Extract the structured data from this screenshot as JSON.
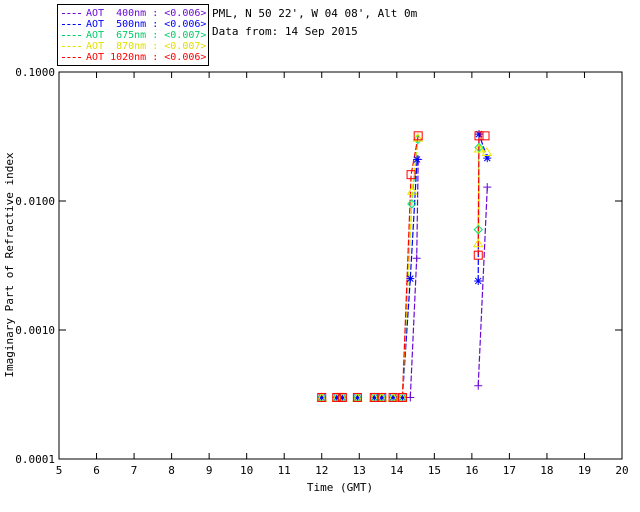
{
  "header": {
    "line1": "PML, N 50 22', W 04 08', Alt 0m",
    "line2": "Data from: 14 Sep 2015"
  },
  "legend": {
    "entries": [
      {
        "label": "AOT  400nm : <0.006>",
        "color": "#6a0ad6"
      },
      {
        "label": "AOT  500nm : <0.006>",
        "color": "#0000ff"
      },
      {
        "label": "AOT  675nm : <0.007>",
        "color": "#00cc66"
      },
      {
        "label": "AOT  870nm : <0.007>",
        "color": "#e0e000"
      },
      {
        "label": "AOT 1020nm : <0.006>",
        "color": "#ff0000"
      }
    ]
  },
  "chart_data": {
    "type": "line",
    "title": "",
    "xlabel": "Time (GMT)",
    "ylabel": "Imaginary Part of Refractive index",
    "xlim": [
      5,
      20
    ],
    "ylim": [
      0.0001,
      0.1
    ],
    "yscale": "log",
    "grid": false,
    "legend_position": "top-left-outside",
    "x_ticks": [
      5,
      6,
      7,
      8,
      9,
      10,
      11,
      12,
      13,
      14,
      15,
      16,
      17,
      18,
      19,
      20
    ],
    "y_ticks": [
      {
        "v": 0.1,
        "label": "0.1000"
      },
      {
        "v": 0.01,
        "label": "0.0100"
      },
      {
        "v": 0.001,
        "label": "0.0010"
      },
      {
        "v": 0.0001,
        "label": "0.0001"
      }
    ],
    "flat_times": [
      12.0,
      12.4,
      12.55,
      12.95,
      13.4,
      13.6,
      13.9
    ],
    "flat_value": 0.0003,
    "series": [
      {
        "name": "AOT 400nm",
        "wavelength": "400nm",
        "mean": "<0.006>",
        "color": "#6a0ad6",
        "marker": "plus",
        "segments": [
          [
            [
              14.36,
              0.0003
            ],
            [
              14.53,
              0.0036
            ],
            [
              14.57,
              0.021
            ]
          ],
          [
            [
              16.17,
              0.00037
            ],
            [
              16.41,
              0.0128
            ]
          ]
        ],
        "extra_points": []
      },
      {
        "name": "AOT 500nm",
        "wavelength": "500nm",
        "mean": "<0.006>",
        "color": "#0000ff",
        "marker": "asterisk",
        "segments": [
          [
            [
              14.15,
              0.0003
            ],
            [
              14.36,
              0.0025
            ],
            [
              14.54,
              0.021
            ]
          ],
          [
            [
              16.17,
              0.0024
            ],
            [
              16.19,
              0.033
            ],
            [
              16.41,
              0.0215
            ]
          ]
        ],
        "extra_points": []
      },
      {
        "name": "AOT 675nm",
        "wavelength": "675nm",
        "mean": "<0.007>",
        "color": "#00e673",
        "marker": "diamond",
        "segments": [
          [
            [
              14.15,
              0.0003
            ],
            [
              14.4,
              0.0095
            ],
            [
              14.56,
              0.03
            ]
          ],
          [
            [
              16.17,
              0.006
            ],
            [
              16.19,
              0.026
            ]
          ]
        ],
        "extra_points": []
      },
      {
        "name": "AOT 870nm",
        "wavelength": "870nm",
        "mean": "<0.007>",
        "color": "#e8e800",
        "marker": "triangle",
        "segments": [
          [
            [
              14.15,
              0.0003
            ],
            [
              14.41,
              0.012
            ],
            [
              14.56,
              0.031
            ]
          ],
          [
            [
              16.17,
              0.0047
            ],
            [
              16.19,
              0.0255
            ],
            [
              16.4,
              0.024
            ]
          ]
        ],
        "extra_points": []
      },
      {
        "name": "AOT 1020nm",
        "wavelength": "1020nm",
        "mean": "<0.006>",
        "color": "#ff0000",
        "marker": "square",
        "segments": [
          [
            [
              14.15,
              0.0003
            ],
            [
              14.38,
              0.016
            ],
            [
              14.57,
              0.032
            ]
          ],
          [
            [
              16.17,
              0.0038
            ],
            [
              16.19,
              0.032
            ]
          ]
        ],
        "extra_points": [
          [
            16.35,
            0.032
          ]
        ]
      }
    ]
  }
}
